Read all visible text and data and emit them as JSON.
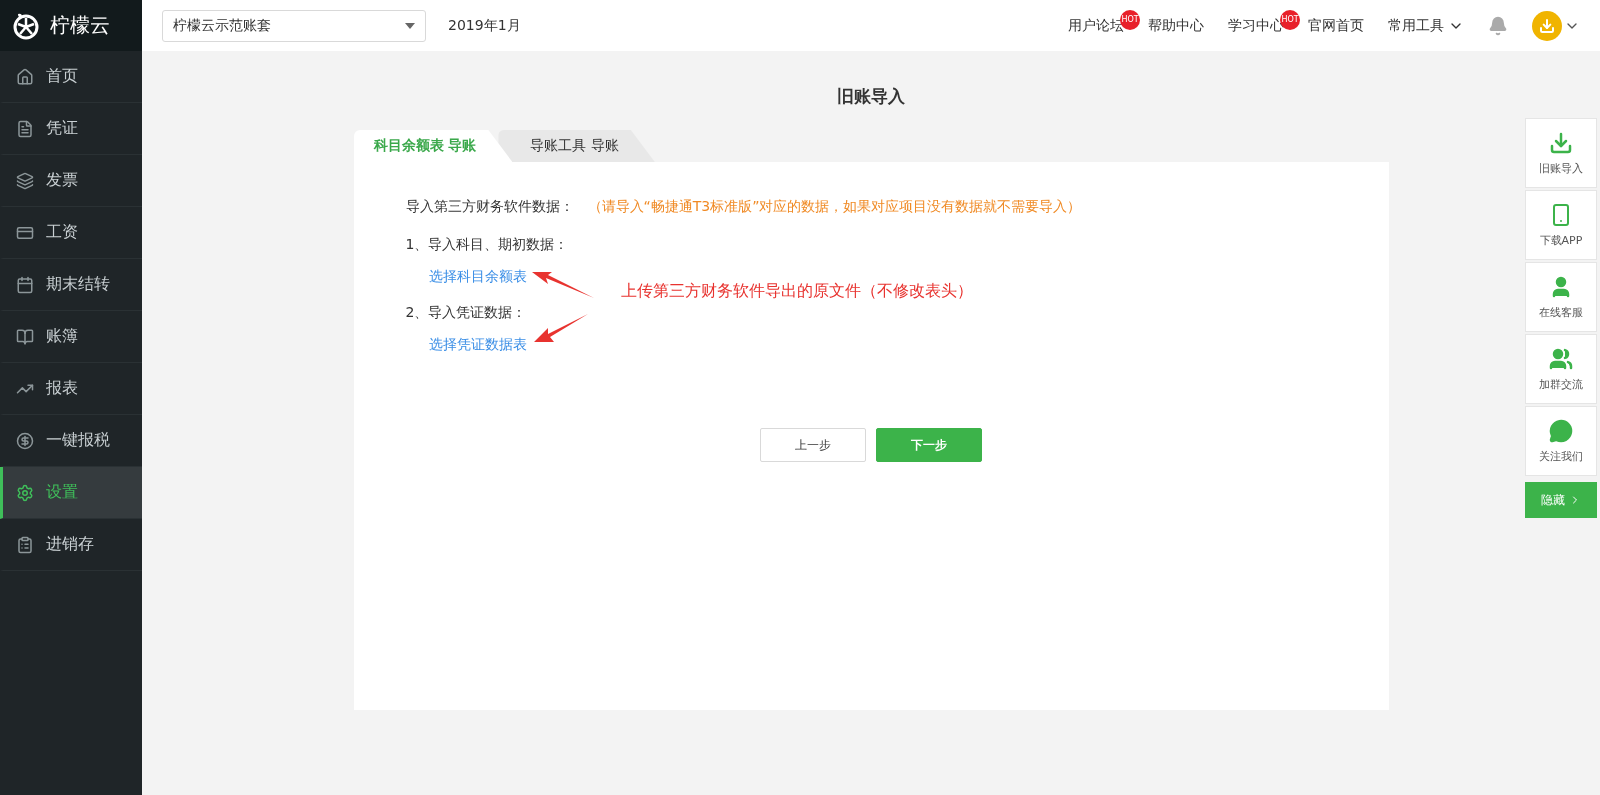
{
  "logo": {
    "text": "柠檬云"
  },
  "account_select": {
    "value": "柠檬云示范账套"
  },
  "period": "2019年1月",
  "top_links": [
    {
      "label": "用户论坛",
      "badge": "HOT",
      "kind": "link"
    },
    {
      "label": "帮助中心",
      "kind": "link"
    },
    {
      "label": "学习中心",
      "badge": "HOT",
      "kind": "link"
    },
    {
      "label": "官网首页",
      "kind": "link"
    },
    {
      "label": "常用工具",
      "kind": "menu"
    }
  ],
  "sidebar": {
    "items": [
      {
        "label": "首页",
        "selected": false
      },
      {
        "label": "凭证",
        "selected": false
      },
      {
        "label": "发票",
        "selected": false
      },
      {
        "label": "工资",
        "selected": false
      },
      {
        "label": "期末结转",
        "selected": false
      },
      {
        "label": "账簿",
        "selected": false
      },
      {
        "label": "报表",
        "selected": false
      },
      {
        "label": "一键报税",
        "selected": false
      },
      {
        "label": "设置",
        "selected": true
      },
      {
        "label": "进销存",
        "selected": false
      }
    ]
  },
  "page_title": "旧账导入",
  "tabs": [
    {
      "label": "科目余额表 导账",
      "selected": true
    },
    {
      "label": "导账工具 导账",
      "selected": false
    }
  ],
  "intro": {
    "label": "导入第三方财务软件数据：",
    "hint": "（请导入“畅捷通T3标准版”对应的数据，如果对应项目没有数据就不需要导入）"
  },
  "steps": [
    {
      "title": "1、导入科目、期初数据：",
      "link": "选择科目余额表"
    },
    {
      "title": "2、导入凭证数据：",
      "link": "选择凭证数据表"
    }
  ],
  "annotation": "上传第三方财务软件导出的原文件（不修改表头）",
  "buttons": [
    {
      "label": "上一步",
      "kind": "secondary"
    },
    {
      "label": "下一步",
      "kind": "primary"
    }
  ],
  "float_panel": {
    "items": [
      "旧账导入",
      "下载APP",
      "在线客服",
      "加群交流",
      "关注我们"
    ],
    "hide_button": "隐藏"
  }
}
